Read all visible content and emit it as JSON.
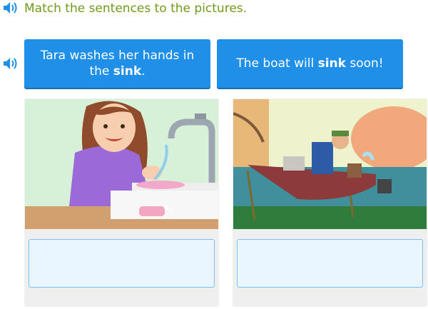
{
  "instruction": "Match the sentences to the pictures.",
  "icons": {
    "speaker": "speaker-icon",
    "color": "#1f8fe8"
  },
  "sentences": [
    {
      "before": "Tara washes her hands in the ",
      "bold": "sink",
      "after": "."
    },
    {
      "before": "The boat will ",
      "bold": "sink",
      "after": " soon!"
    }
  ],
  "pictures": [
    {
      "description_name": "girl-washing-hands-image"
    },
    {
      "description_name": "man-in-sinking-boat-image"
    }
  ],
  "colors": {
    "instruction_text": "#6f9a17",
    "button_bg": "#1f8fe8",
    "drop_bg": "#e9f5ff",
    "drop_border": "#7cc0f0",
    "card_bg": "#efefef"
  }
}
